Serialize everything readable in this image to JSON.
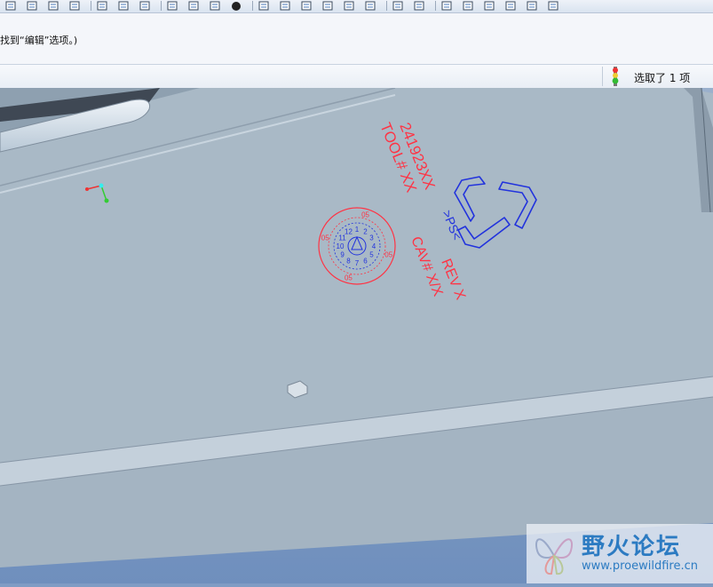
{
  "toolbar": {
    "buttons": [
      {
        "name": "copy-icon"
      },
      {
        "name": "paste-icon"
      },
      {
        "name": "table-icon"
      },
      {
        "name": "grid-icon"
      },
      {
        "name": "layers-icon"
      },
      {
        "name": "tree-icon"
      },
      {
        "name": "box-select-icon"
      },
      {
        "name": "refit-icon"
      },
      {
        "name": "repaint-icon"
      },
      {
        "name": "spin-icon"
      },
      {
        "name": "sphere-icon"
      },
      {
        "name": "pointer-icon"
      },
      {
        "name": "zoom-in-icon"
      },
      {
        "name": "zoom-out-icon"
      },
      {
        "name": "zoom-fit-icon"
      },
      {
        "name": "reorient-icon"
      },
      {
        "name": "saved-views-icon"
      },
      {
        "name": "layer-icon"
      },
      {
        "name": "view-manager-icon"
      },
      {
        "name": "wireframe-icon"
      },
      {
        "name": "hidden-line-icon"
      },
      {
        "name": "no-hidden-icon"
      },
      {
        "name": "shading-icon"
      },
      {
        "name": "enhanced-shading-icon"
      },
      {
        "name": "datum-icon"
      }
    ]
  },
  "message": {
    "text": "找到“编辑”选项。)"
  },
  "status": {
    "selection_text": "选取了 1 项",
    "light_icon": "traffic-light-icon"
  },
  "model": {
    "stamp_text_part_number": "241923XX",
    "stamp_text_tool": "TOOL# XX",
    "stamp_text_material": ">PS<",
    "stamp_text_rev": "REV X",
    "stamp_text_cav": "CAV# X/X",
    "date_wheel_years": [
      "05",
      "05",
      "05",
      "05"
    ],
    "date_wheel_months": [
      "1",
      "2",
      "3",
      "4",
      "5",
      "6",
      "7",
      "8",
      "9",
      "10",
      "11",
      "12"
    ],
    "colors": {
      "stamp_red": "#ff3344",
      "stamp_blue": "#2233dd",
      "part_gray": "#a9b9c6",
      "background_blue": "#7f9cc4"
    }
  },
  "watermark": {
    "title": "野火论坛",
    "url": "www.proewildfire.cn"
  }
}
